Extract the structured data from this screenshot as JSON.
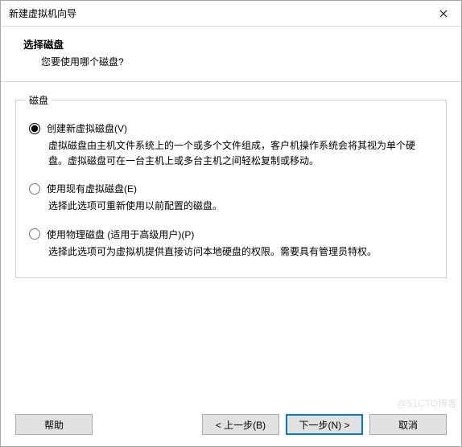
{
  "window": {
    "title": "新建虚拟机向导"
  },
  "header": {
    "title": "选择磁盘",
    "subtitle": "您要使用哪个磁盘?"
  },
  "group": {
    "legend": "磁盘",
    "options": [
      {
        "label": "创建新虚拟磁盘(V)",
        "description": "虚拟磁盘由主机文件系统上的一个或多个文件组成，客户机操作系统会将其视为单个硬盘。虚拟磁盘可在一台主机上或多台主机之间轻松复制或移动。",
        "checked": true
      },
      {
        "label": "使用现有虚拟磁盘(E)",
        "description": "选择此选项可重新使用以前配置的磁盘。",
        "checked": false
      },
      {
        "label": "使用物理磁盘 (适用于高级用户)(P)",
        "description": "选择此选项可为虚拟机提供直接访问本地硬盘的权限。需要具有管理员特权。",
        "checked": false
      }
    ]
  },
  "buttons": {
    "help": "帮助",
    "back": "< 上一步(B)",
    "next": "下一步(N) >",
    "cancel": "取消"
  },
  "watermark": "@51CTO博客"
}
